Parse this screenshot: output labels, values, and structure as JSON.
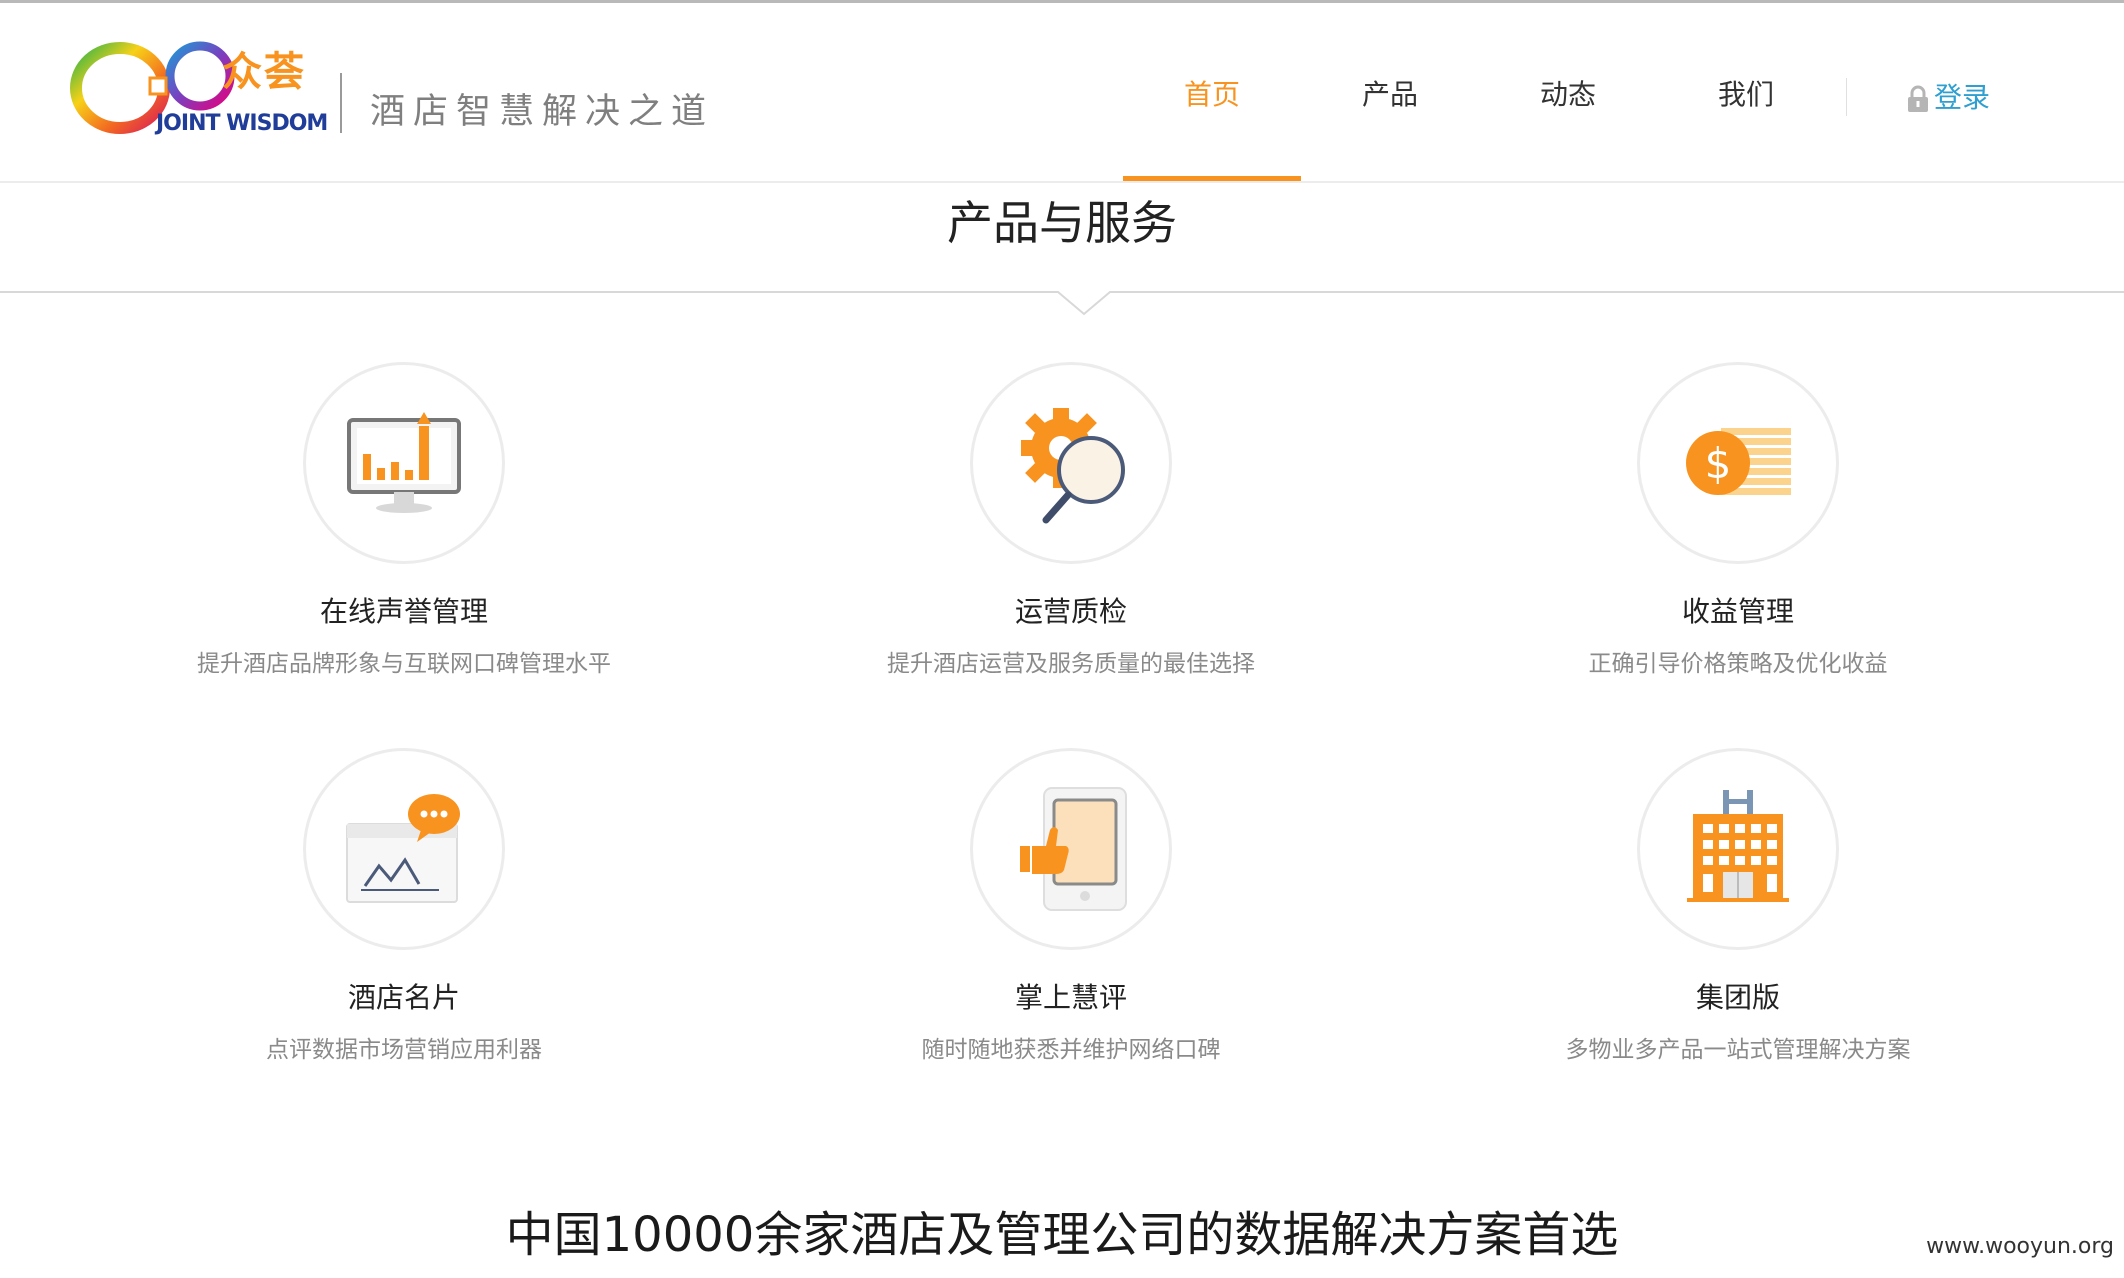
{
  "header": {
    "logo_cn": "众荟",
    "logo_en": "JOINT WISDOM",
    "slogan": "酒店智慧解决之道",
    "nav": [
      {
        "label": "首页",
        "active": true
      },
      {
        "label": "产品",
        "active": false
      },
      {
        "label": "动态",
        "active": false
      },
      {
        "label": "我们",
        "active": false
      }
    ],
    "login_label": "登录",
    "accent_color": "#f7931e",
    "login_color": "#2e9fd0"
  },
  "section": {
    "title": "产品与服务"
  },
  "products": [
    {
      "title": "在线声誉管理",
      "desc": "提升酒店品牌形象与互联网口碑管理水平",
      "icon": "monitor-chart-icon"
    },
    {
      "title": "运营质检",
      "desc": "提升酒店运营及服务质量的最佳选择",
      "icon": "gear-magnifier-icon"
    },
    {
      "title": "收益管理",
      "desc": "正确引导价格策略及优化收益",
      "icon": "dollar-coin-icon"
    },
    {
      "title": "酒店名片",
      "desc": "点评数据市场营销应用利器",
      "icon": "chat-chart-icon"
    },
    {
      "title": "掌上慧评",
      "desc": "随时随地获悉并维护网络口碑",
      "icon": "mobile-thumbs-up-icon"
    },
    {
      "title": "集团版",
      "desc": "多物业多产品一站式管理解决方案",
      "icon": "hotel-building-icon"
    }
  ],
  "headline": "中国10000余家酒店及管理公司的数据解决方案首选",
  "watermark": "www.wooyun.org"
}
